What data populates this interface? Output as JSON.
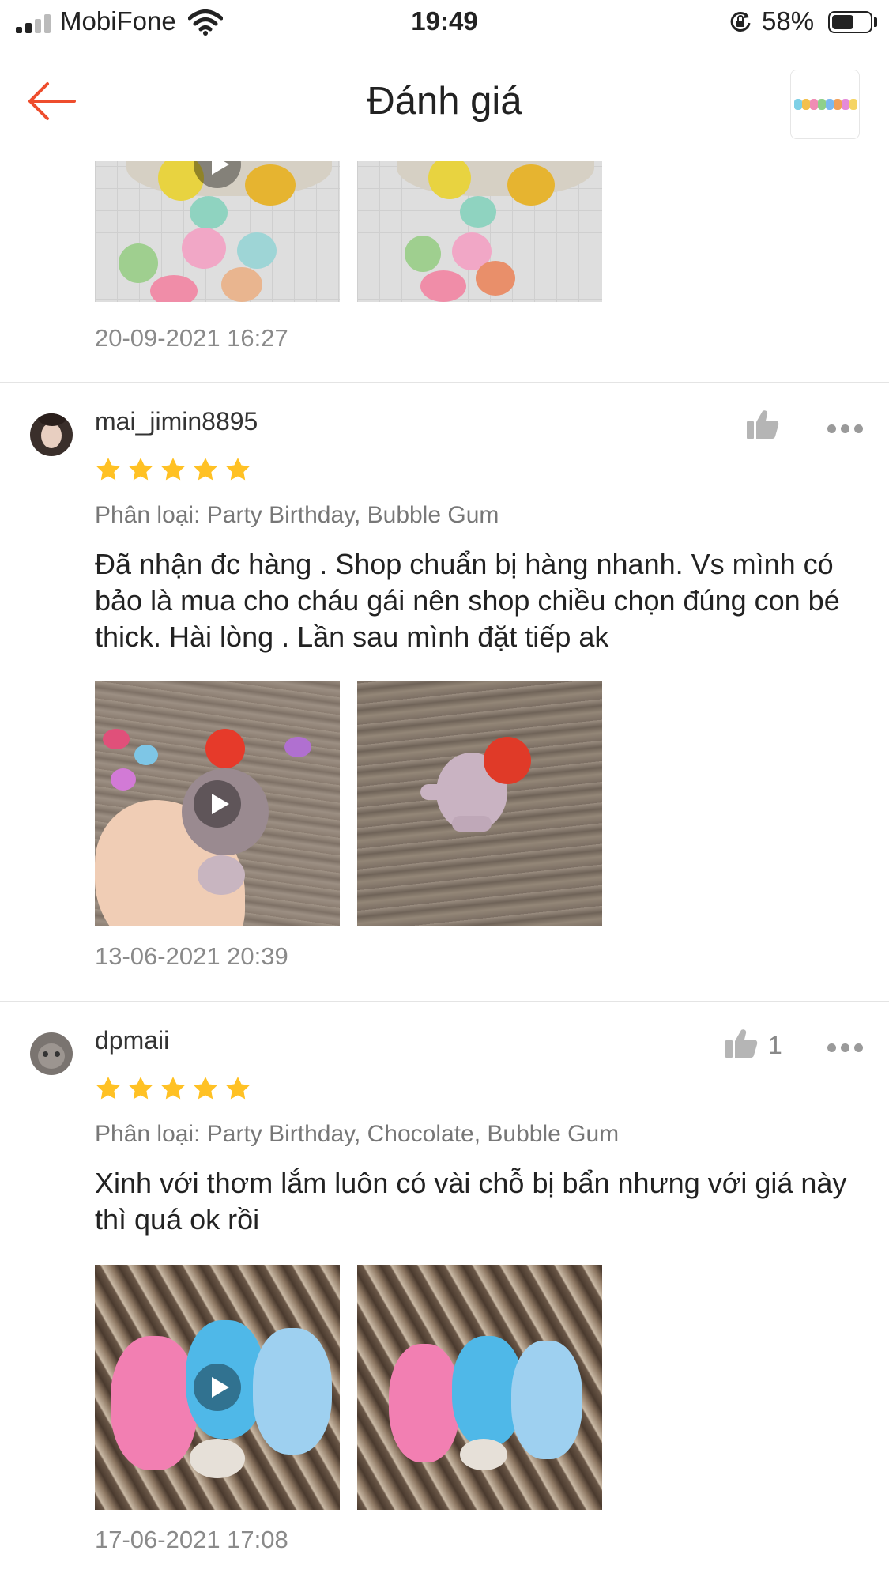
{
  "status": {
    "carrier": "MobiFone",
    "time": "19:49",
    "battery": "58%",
    "battery_level": 0.58
  },
  "header": {
    "title": "Đánh giá"
  },
  "reviews": [
    {
      "date": "20-09-2021 16:27"
    },
    {
      "username": "mai_jimin8895",
      "rating": 5,
      "variation": "Phân loại: Party Birthday, Bubble Gum",
      "comment": "Đã nhận đc hàng . Shop chuẩn bị hàng nhanh. Vs mình có bảo là mua cho cháu gái nên shop chiều chọn đúng con bé thick. Hài lòng . Lần sau mình đặt tiếp ak",
      "date": "13-06-2021 20:39"
    },
    {
      "username": "dpmaii",
      "rating": 5,
      "likes": "1",
      "variation": "Phân loại: Party Birthday, Chocolate, Bubble Gum",
      "comment": "Xinh với thơm lắm luôn có vài chỗ bị bẩn nhưng với giá này thì quá ok rồi",
      "date": "17-06-2021 17:08"
    }
  ],
  "colors": {
    "accent": "#ee4d2d",
    "star": "#ffc124",
    "text": "#222222",
    "muted": "#8a8a8a"
  },
  "icons": [
    "back-arrow-icon",
    "like-icon",
    "more-icon",
    "play-icon",
    "star-icon",
    "wifi-icon",
    "signal-icon",
    "battery-icon"
  ]
}
